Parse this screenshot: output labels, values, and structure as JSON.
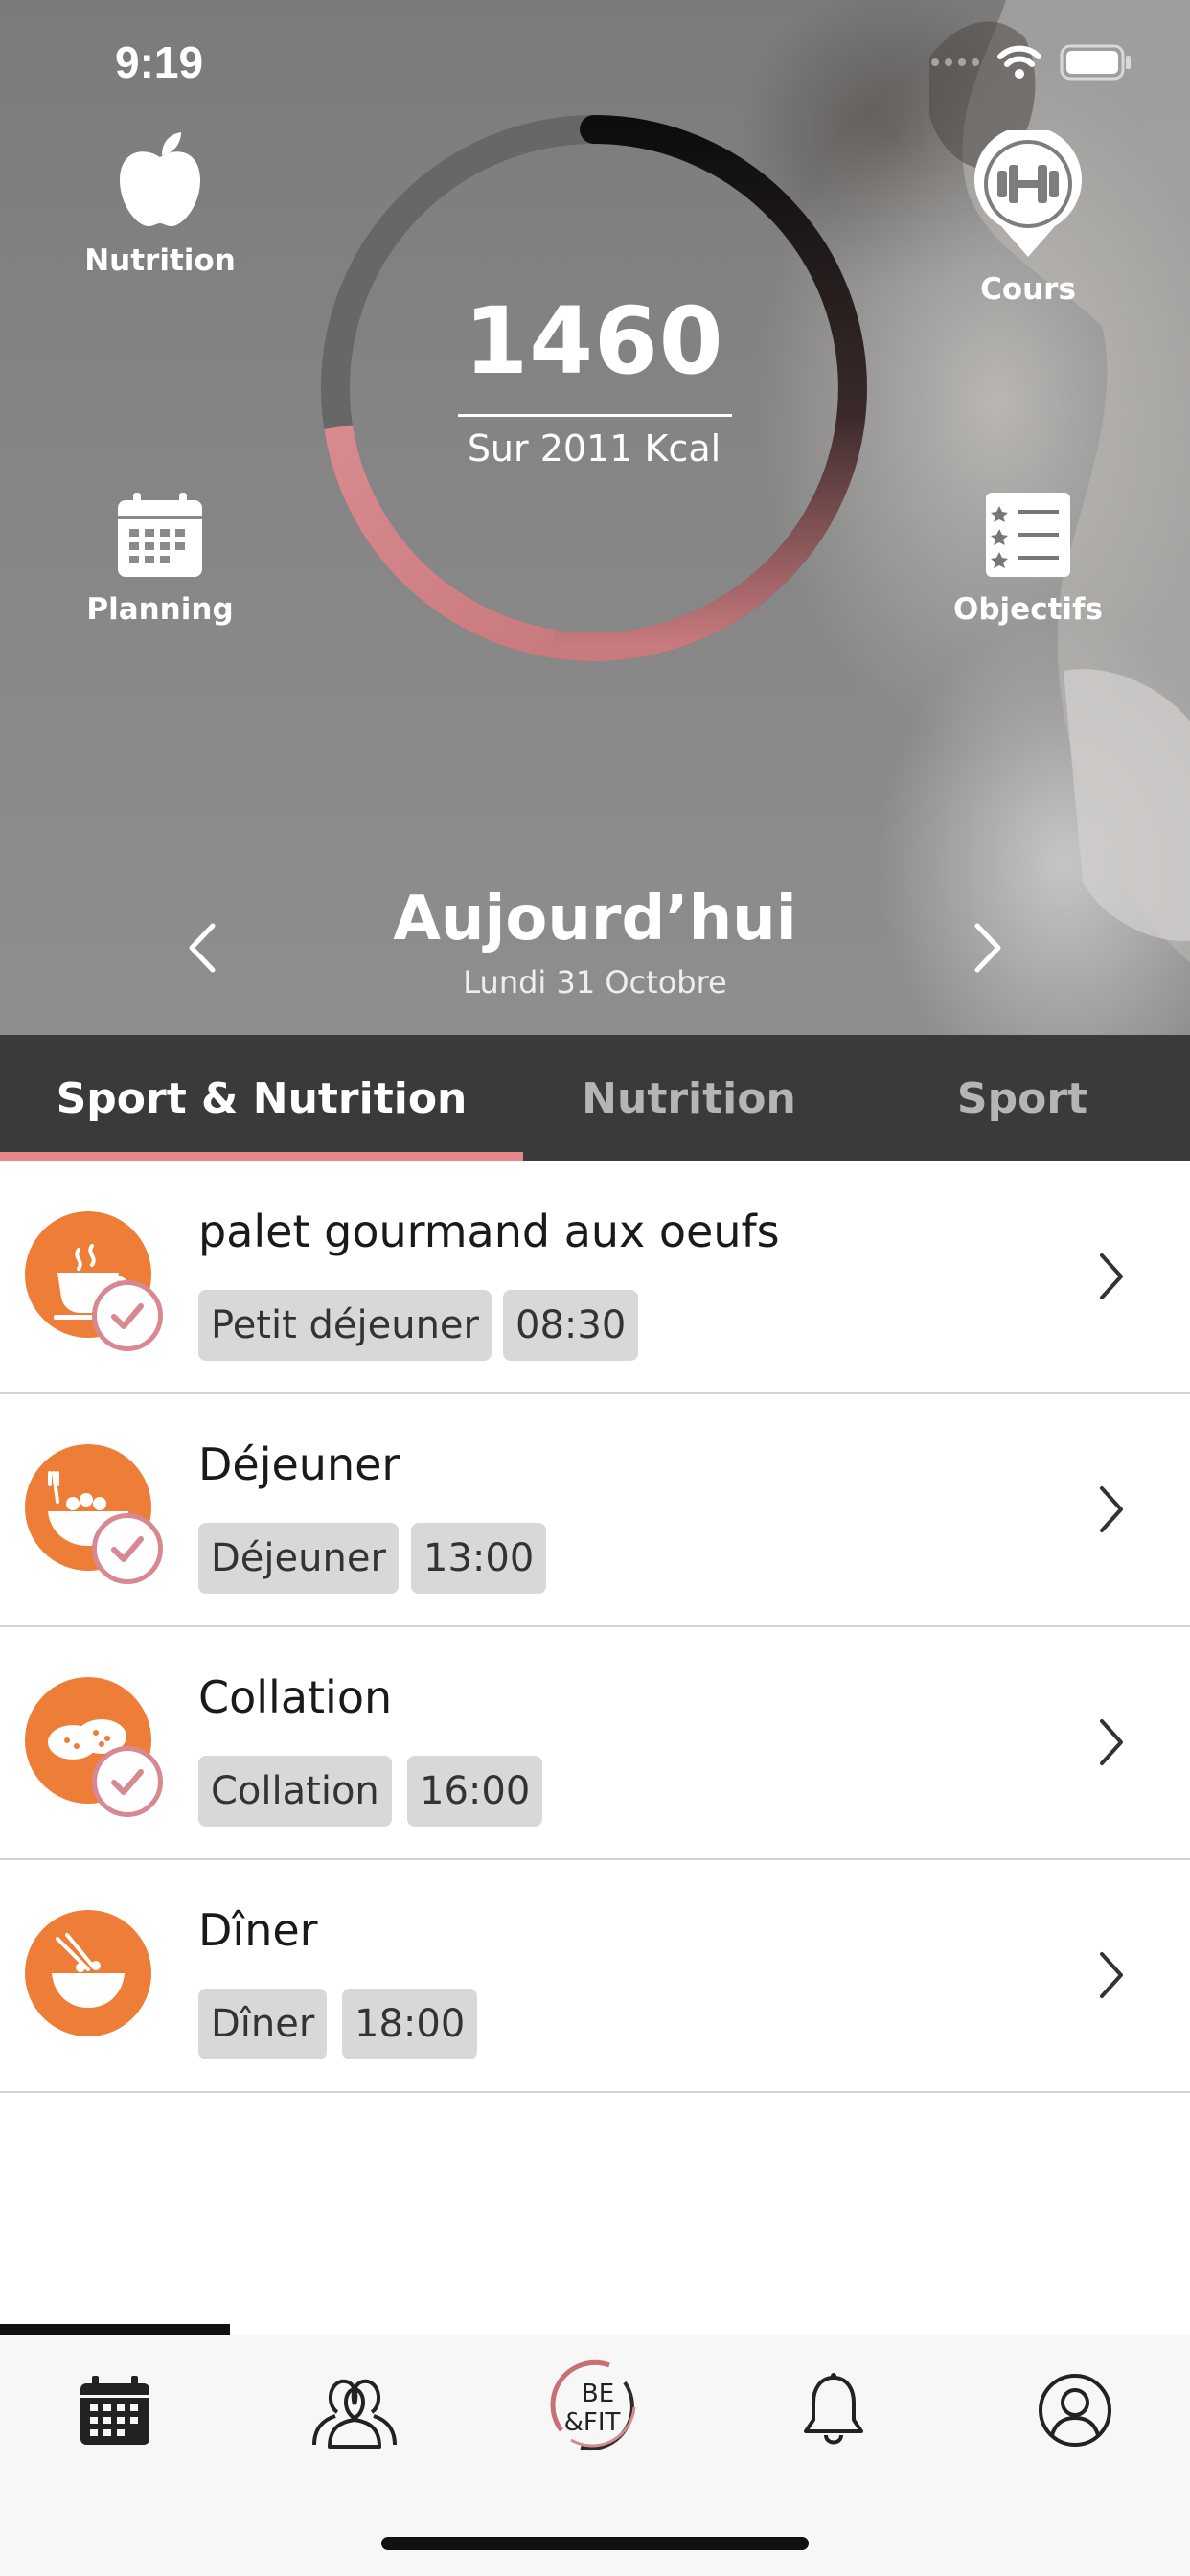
{
  "status": {
    "time": "9:19"
  },
  "quick_actions": {
    "nutrition": "Nutrition",
    "planning": "Planning",
    "cours": "Cours",
    "objectifs": "Objectifs"
  },
  "calories": {
    "consumed": "1460",
    "subtitle": "Sur 2011 Kcal",
    "progress_fraction": 0.726
  },
  "day": {
    "title": "Aujourd’hui",
    "date": "Lundi 31 Octobre"
  },
  "tabs": [
    {
      "label": "Sport & Nutrition",
      "active": true
    },
    {
      "label": "Nutrition",
      "active": false
    },
    {
      "label": "Sport",
      "active": false
    }
  ],
  "meals": [
    {
      "title": "palet gourmand aux oeufs",
      "category": "Petit déjeuner",
      "time": "08:30",
      "done": true,
      "icon": "breakfast-cup-icon"
    },
    {
      "title": "Déjeuner",
      "category": "Déjeuner",
      "time": "13:00",
      "done": true,
      "icon": "lunch-bowl-icon"
    },
    {
      "title": "Collation",
      "category": "Collation",
      "time": "16:00",
      "done": true,
      "icon": "snack-biscuits-icon"
    },
    {
      "title": "Dîner",
      "category": "Dîner",
      "time": "18:00",
      "done": false,
      "icon": "dinner-bowl-icon"
    }
  ],
  "bottom_nav": {
    "items": [
      "calendar-icon",
      "community-icon",
      "befit-logo",
      "bell-icon",
      "profile-icon"
    ],
    "logo_text_top": "BE",
    "logo_text_bottom": "&FIT",
    "active_index": 0
  },
  "colors": {
    "accent_orange": "#ee7d37",
    "accent_pink": "#e8868a",
    "tab_bar": "#3a3a3a"
  }
}
